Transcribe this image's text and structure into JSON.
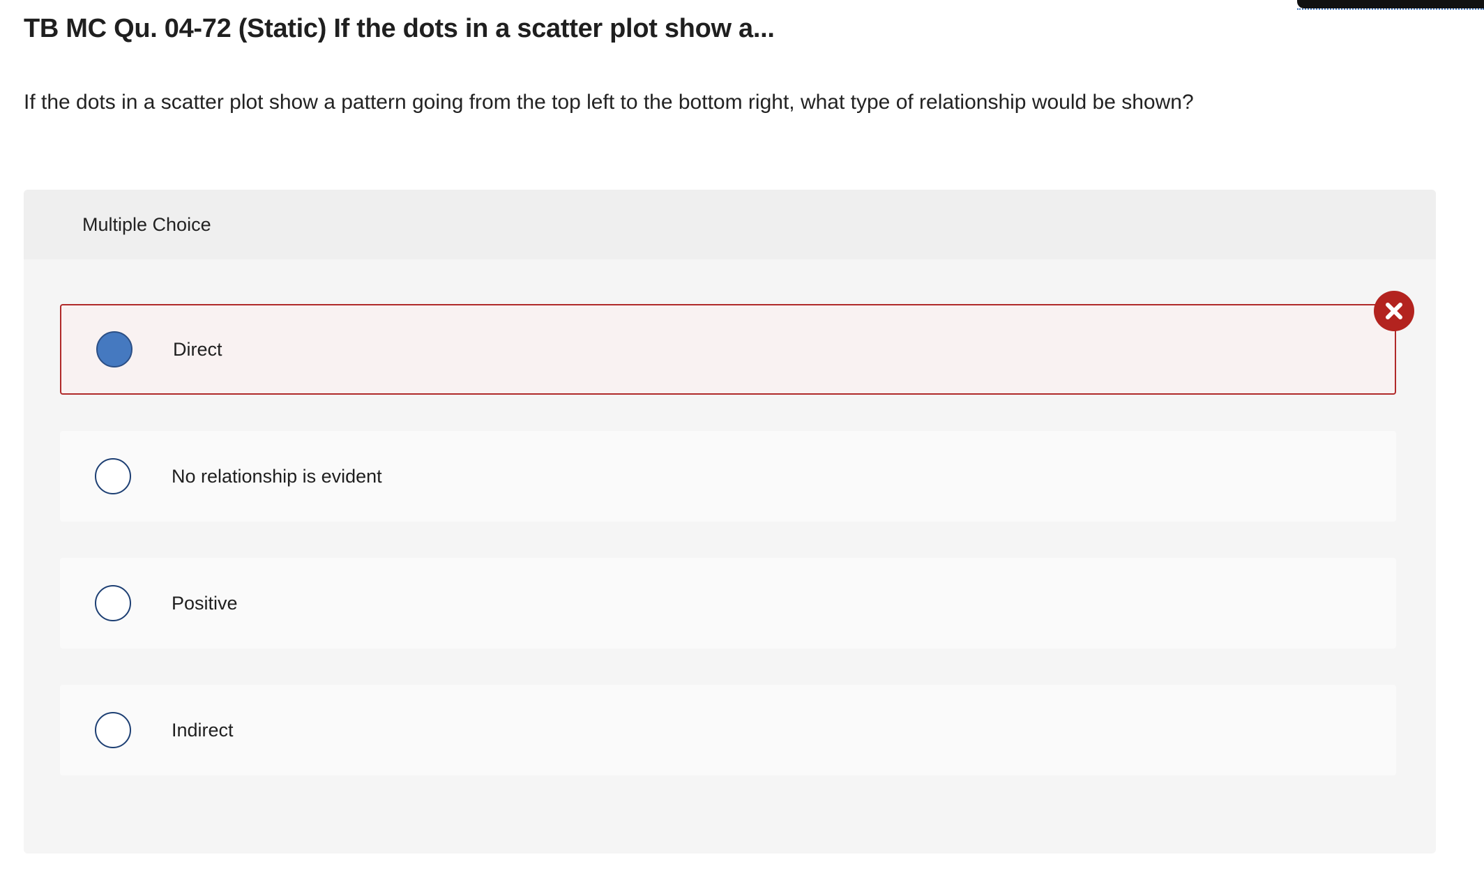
{
  "question": {
    "title": "TB MC Qu. 04-72 (Static) If the dots in a scatter plot show a...",
    "text": "If the dots in a scatter plot show a pattern going from the top left to the bottom right, what type of relationship would be shown?"
  },
  "multiple_choice": {
    "header": "Multiple Choice",
    "options": [
      {
        "label": "Direct",
        "selected": true,
        "status": "incorrect"
      },
      {
        "label": "No relationship is evident",
        "selected": false
      },
      {
        "label": "Positive",
        "selected": false
      },
      {
        "label": "Indirect",
        "selected": false
      }
    ]
  },
  "icons": {
    "wrong": "close-x-icon"
  },
  "colors": {
    "incorrect_red": "#b3231f",
    "selected_radio_blue": "#4579c0",
    "panel_background": "#f5f5f5"
  }
}
